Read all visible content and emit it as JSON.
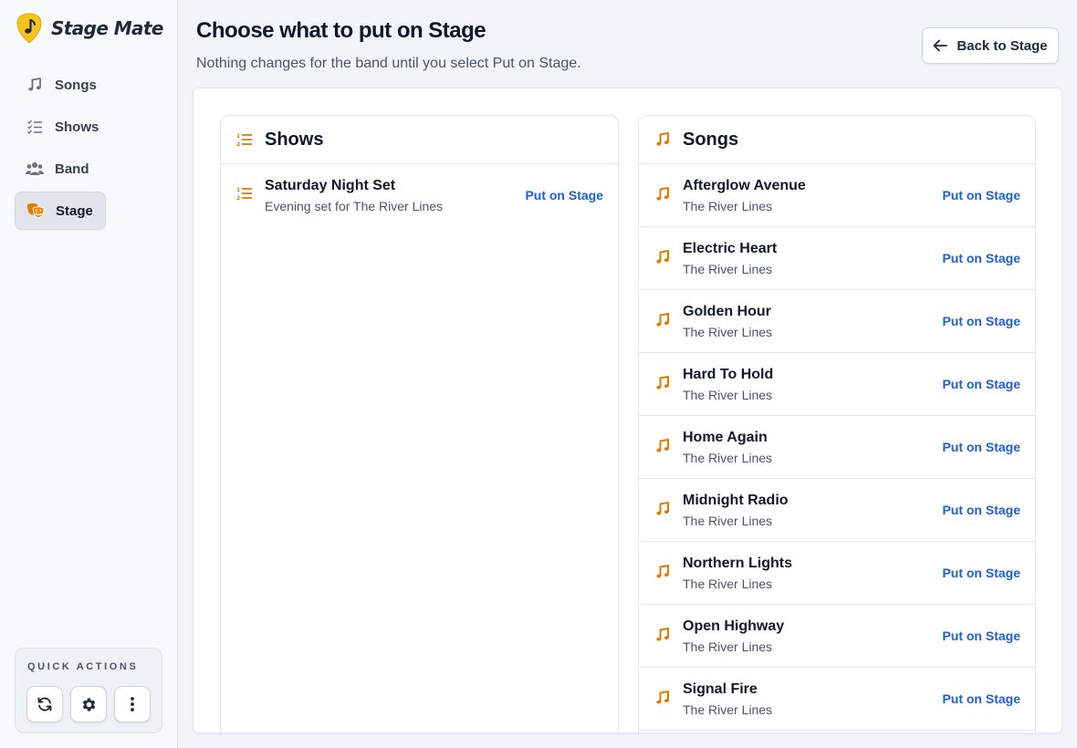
{
  "app": {
    "name": "Stage Mate"
  },
  "colors": {
    "accent": "#e07b00",
    "link": "#1d5fd6",
    "logo": "#f6c21c"
  },
  "sidebar": {
    "items": [
      {
        "label": "Songs",
        "icon": "music-note-icon"
      },
      {
        "label": "Shows",
        "icon": "list-check-icon"
      },
      {
        "label": "Band",
        "icon": "users-icon"
      },
      {
        "label": "Stage",
        "icon": "theater-masks-icon",
        "active": true
      }
    ],
    "quick_actions": {
      "title": "QUICK ACTIONS",
      "buttons": [
        "refresh-icon",
        "gear-icon",
        "more-vertical-icon"
      ]
    }
  },
  "header": {
    "title": "Choose what to put on Stage",
    "subtitle": "Nothing changes for the band until you select Put on Stage.",
    "back_label": "Back to Stage"
  },
  "shows": {
    "title": "Shows",
    "items": [
      {
        "title": "Saturday Night Set",
        "subtitle": "Evening set for The River Lines",
        "action": "Put on Stage"
      }
    ]
  },
  "songs": {
    "title": "Songs",
    "items": [
      {
        "title": "Afterglow Avenue",
        "subtitle": "The River Lines",
        "action": "Put on Stage"
      },
      {
        "title": "Electric Heart",
        "subtitle": "The River Lines",
        "action": "Put on Stage"
      },
      {
        "title": "Golden Hour",
        "subtitle": "The River Lines",
        "action": "Put on Stage"
      },
      {
        "title": "Hard To Hold",
        "subtitle": "The River Lines",
        "action": "Put on Stage"
      },
      {
        "title": "Home Again",
        "subtitle": "The River Lines",
        "action": "Put on Stage"
      },
      {
        "title": "Midnight Radio",
        "subtitle": "The River Lines",
        "action": "Put on Stage"
      },
      {
        "title": "Northern Lights",
        "subtitle": "The River Lines",
        "action": "Put on Stage"
      },
      {
        "title": "Open Highway",
        "subtitle": "The River Lines",
        "action": "Put on Stage"
      },
      {
        "title": "Signal Fire",
        "subtitle": "The River Lines",
        "action": "Put on Stage"
      }
    ]
  }
}
